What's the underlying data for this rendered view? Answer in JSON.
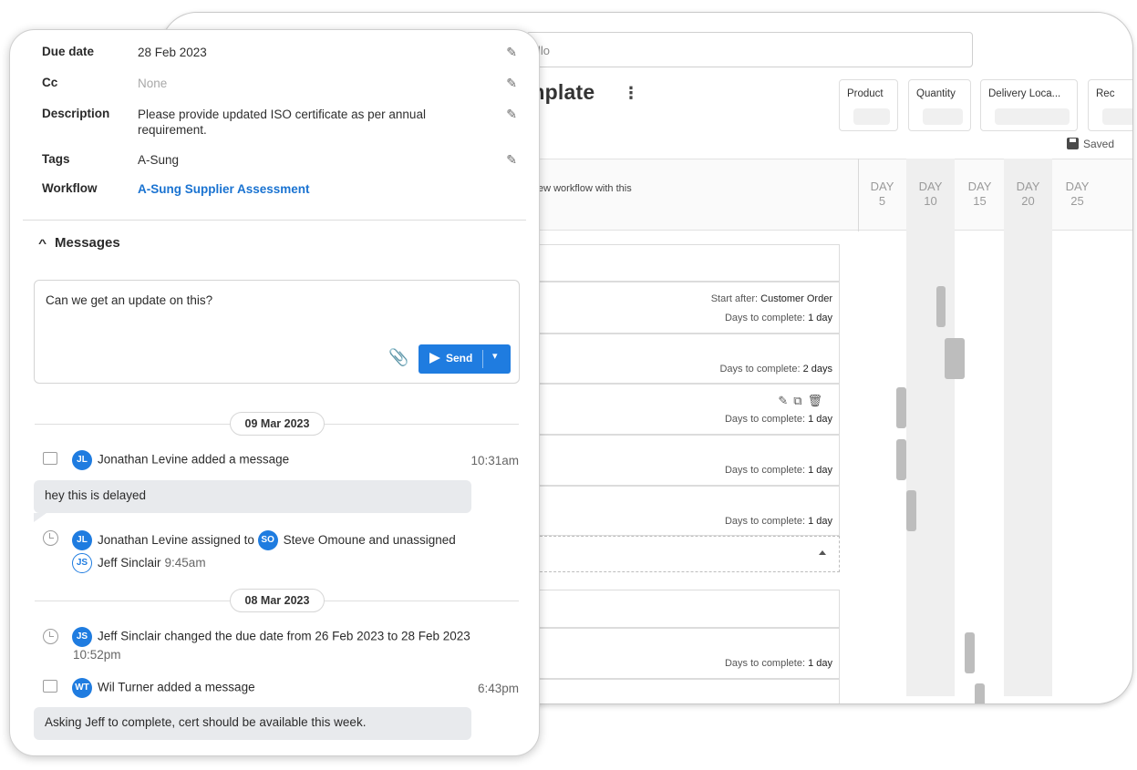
{
  "back": {
    "search_value": "llo",
    "title_fragment": "mplate",
    "more_glyph": "⋮",
    "fields": [
      "Product",
      "Quantity",
      "Delivery Loca...",
      "Rec"
    ],
    "saved_label": "Saved",
    "header_text": "ew workflow with this",
    "days": [
      {
        "line1": "DAY",
        "line2": "5"
      },
      {
        "line1": "DAY",
        "line2": "10"
      },
      {
        "line1": "DAY",
        "line2": "15"
      },
      {
        "line1": "DAY",
        "line2": "20"
      },
      {
        "line1": "DAY",
        "line2": "25"
      }
    ],
    "start_after_label": "Start after:",
    "start_after_value": "Customer Order",
    "days_label": "Days to complete:",
    "rows": [
      {
        "days": "1 day"
      },
      {
        "days": "2 days"
      },
      {
        "days": "1 day"
      },
      {
        "days": "1 day"
      },
      {
        "days": "1 day"
      },
      {
        "days": "1 day"
      }
    ],
    "row_icons": "✎⧉🗑"
  },
  "details": {
    "due_date_label": "Due date",
    "due_date_value": "28 Feb 2023",
    "cc_label": "Cc",
    "cc_value": "None",
    "description_label": "Description",
    "description_value": "Please provide updated ISO certificate as per annual requirement.",
    "tags_label": "Tags",
    "tags_value": "A-Sung",
    "workflow_label": "Workflow",
    "workflow_value": "A-Sung Supplier Assessment"
  },
  "messages": {
    "header": "Messages",
    "chevron_glyph": "^",
    "composer_text": "Can we get an update on this?",
    "attach_glyph": "⊘",
    "send_label": "Send",
    "send_dropdown_glyph": "⌄",
    "groups": [
      {
        "date": "09 Mar 2023",
        "events": [
          {
            "avatar": "JL",
            "text": "Jonathan Levine added a message",
            "time": "10:31am",
            "bubble": "hey this is delayed"
          },
          {
            "avatar": "JL",
            "text_a": "Jonathan Levine assigned to",
            "avatar2": "SO",
            "text_b": "Steve Omoune and unassigned",
            "avatar3": "JS",
            "text_c": "Jeff Sinclair",
            "time": "9:45am"
          }
        ]
      },
      {
        "date": "08 Mar 2023",
        "events": [
          {
            "avatar": "JS",
            "text": "Jeff Sinclair changed the due date from 26 Feb 2023 to 28 Feb 2023",
            "time": "10:52pm"
          },
          {
            "avatar": "WT",
            "text": "Wil Turner added a message",
            "time": "6:43pm",
            "bubble": "Asking Jeff to complete, cert should be available this week."
          }
        ]
      }
    ]
  },
  "colors": {
    "accent": "#1f7ce0",
    "bubble": "#e8eaed",
    "gantt_bar": "#bdbdbd"
  }
}
